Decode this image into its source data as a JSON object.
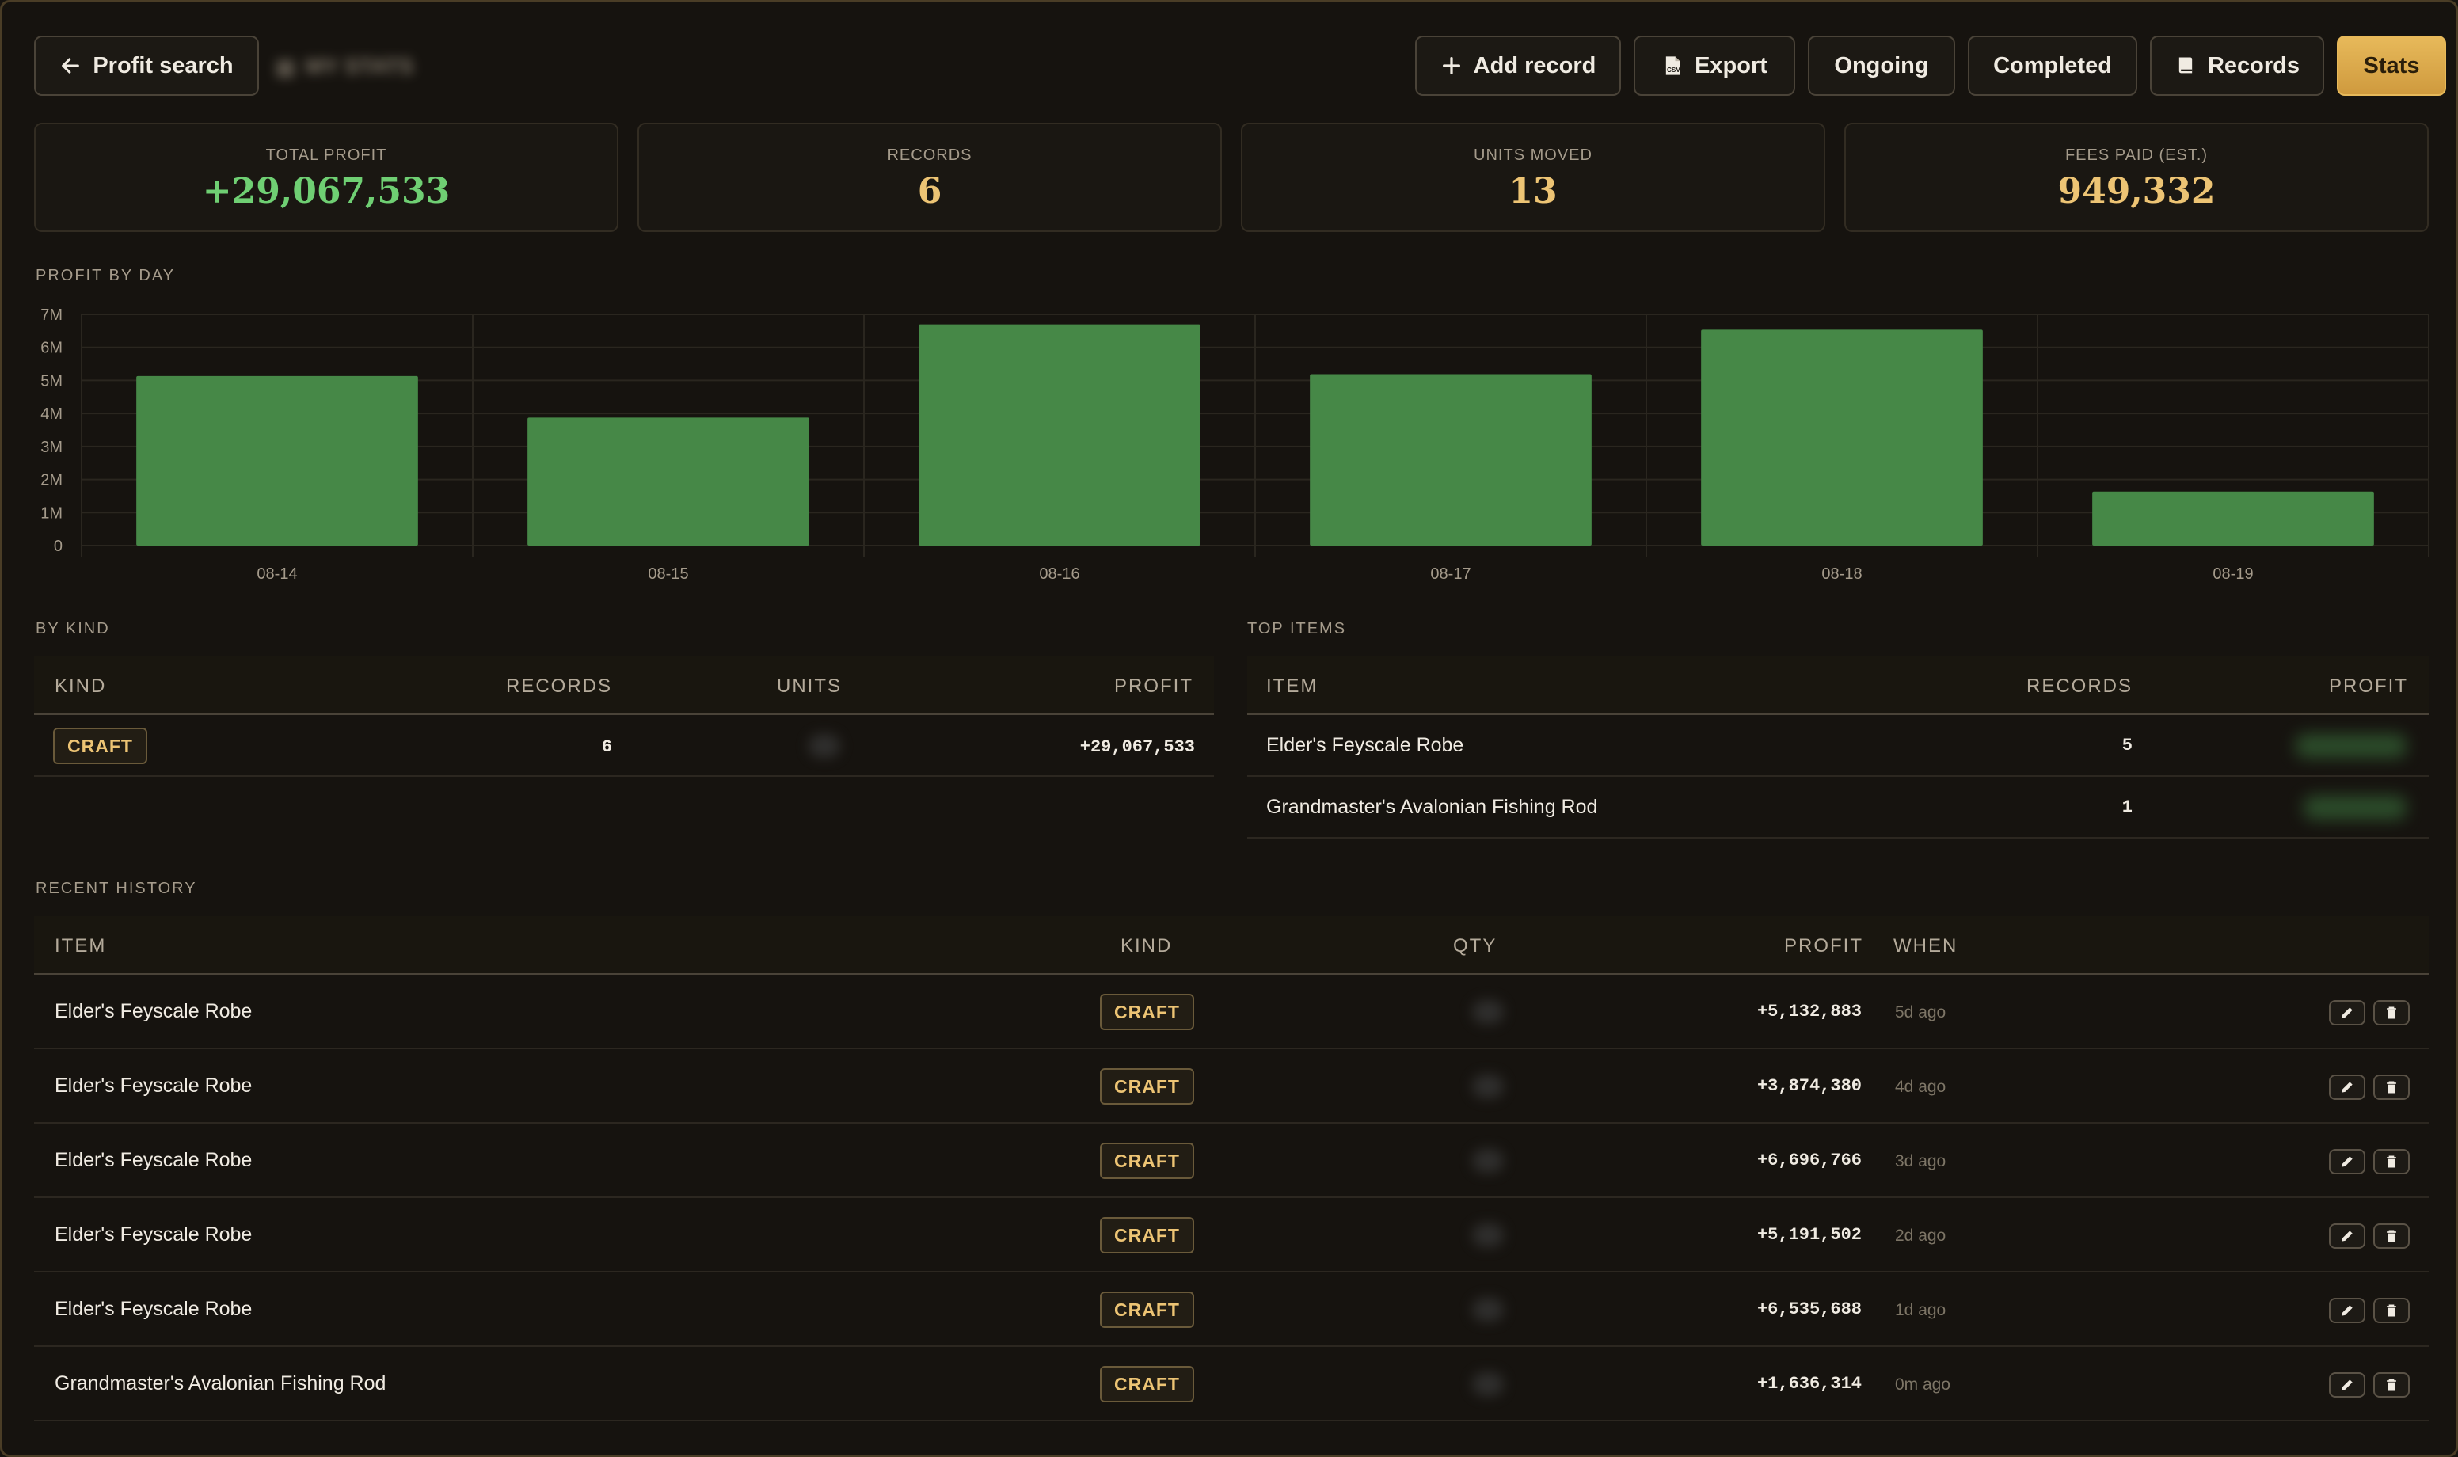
{
  "header": {
    "back_label": "Profit search",
    "page_title": "MY STATS",
    "buttons": {
      "add_record": "Add record",
      "export": "Export",
      "ongoing": "Ongoing",
      "completed": "Completed",
      "records": "Records",
      "stats": "Stats"
    }
  },
  "summary": [
    {
      "label": "TOTAL PROFIT",
      "value": "+29,067,533"
    },
    {
      "label": "RECORDS",
      "value": "6"
    },
    {
      "label": "UNITS MOVED",
      "value": "13"
    },
    {
      "label": "FEES PAID (EST.)",
      "value": "949,332"
    }
  ],
  "sections": {
    "profit_by_day": "PROFIT BY DAY",
    "by_kind": "BY KIND",
    "top_items": "TOP ITEMS",
    "recent_history": "RECENT HISTORY"
  },
  "chart_data": {
    "type": "bar",
    "title": "PROFIT BY DAY",
    "categories": [
      "08-14",
      "08-15",
      "08-16",
      "08-17",
      "08-18",
      "08-19"
    ],
    "values": [
      5132883,
      3874380,
      6696766,
      5191502,
      6535688,
      1636314
    ],
    "ylim": [
      0,
      7000000
    ],
    "yticks": [
      0,
      1000000,
      2000000,
      3000000,
      4000000,
      5000000,
      6000000,
      7000000
    ],
    "ytick_labels": [
      "0",
      "1M",
      "2M",
      "3M",
      "4M",
      "5M",
      "6M",
      "7M"
    ],
    "grid": true,
    "bar_color": "#468847"
  },
  "by_kind": {
    "columns": [
      "KIND",
      "RECORDS",
      "UNITS",
      "PROFIT"
    ],
    "rows": [
      {
        "kind": "CRAFT",
        "records": "6",
        "profit": "+29,067,533"
      }
    ]
  },
  "top_items": {
    "columns": [
      "ITEM",
      "RECORDS",
      "PROFIT"
    ],
    "rows": [
      {
        "item": "Elder's Feyscale Robe",
        "records": "5"
      },
      {
        "item": "Grandmaster's Avalonian Fishing Rod",
        "records": "1"
      }
    ]
  },
  "history": {
    "columns": [
      "ITEM",
      "KIND",
      "QTY",
      "PROFIT",
      "WHEN"
    ],
    "rows": [
      {
        "item": "Elder's Feyscale Robe",
        "kind": "CRAFT",
        "profit": "+5,132,883",
        "when": "5d ago"
      },
      {
        "item": "Elder's Feyscale Robe",
        "kind": "CRAFT",
        "profit": "+3,874,380",
        "when": "4d ago"
      },
      {
        "item": "Elder's Feyscale Robe",
        "kind": "CRAFT",
        "profit": "+6,696,766",
        "when": "3d ago"
      },
      {
        "item": "Elder's Feyscale Robe",
        "kind": "CRAFT",
        "profit": "+5,191,502",
        "when": "2d ago"
      },
      {
        "item": "Elder's Feyscale Robe",
        "kind": "CRAFT",
        "profit": "+6,535,688",
        "when": "1d ago"
      },
      {
        "item": "Grandmaster's Avalonian Fishing Rod",
        "kind": "CRAFT",
        "profit": "+1,636,314",
        "when": "0m ago"
      }
    ]
  },
  "colors": {
    "accent": "#e7b95a",
    "profit_green": "#6fcf73",
    "gold_text": "#edc474",
    "bar": "#468847"
  }
}
